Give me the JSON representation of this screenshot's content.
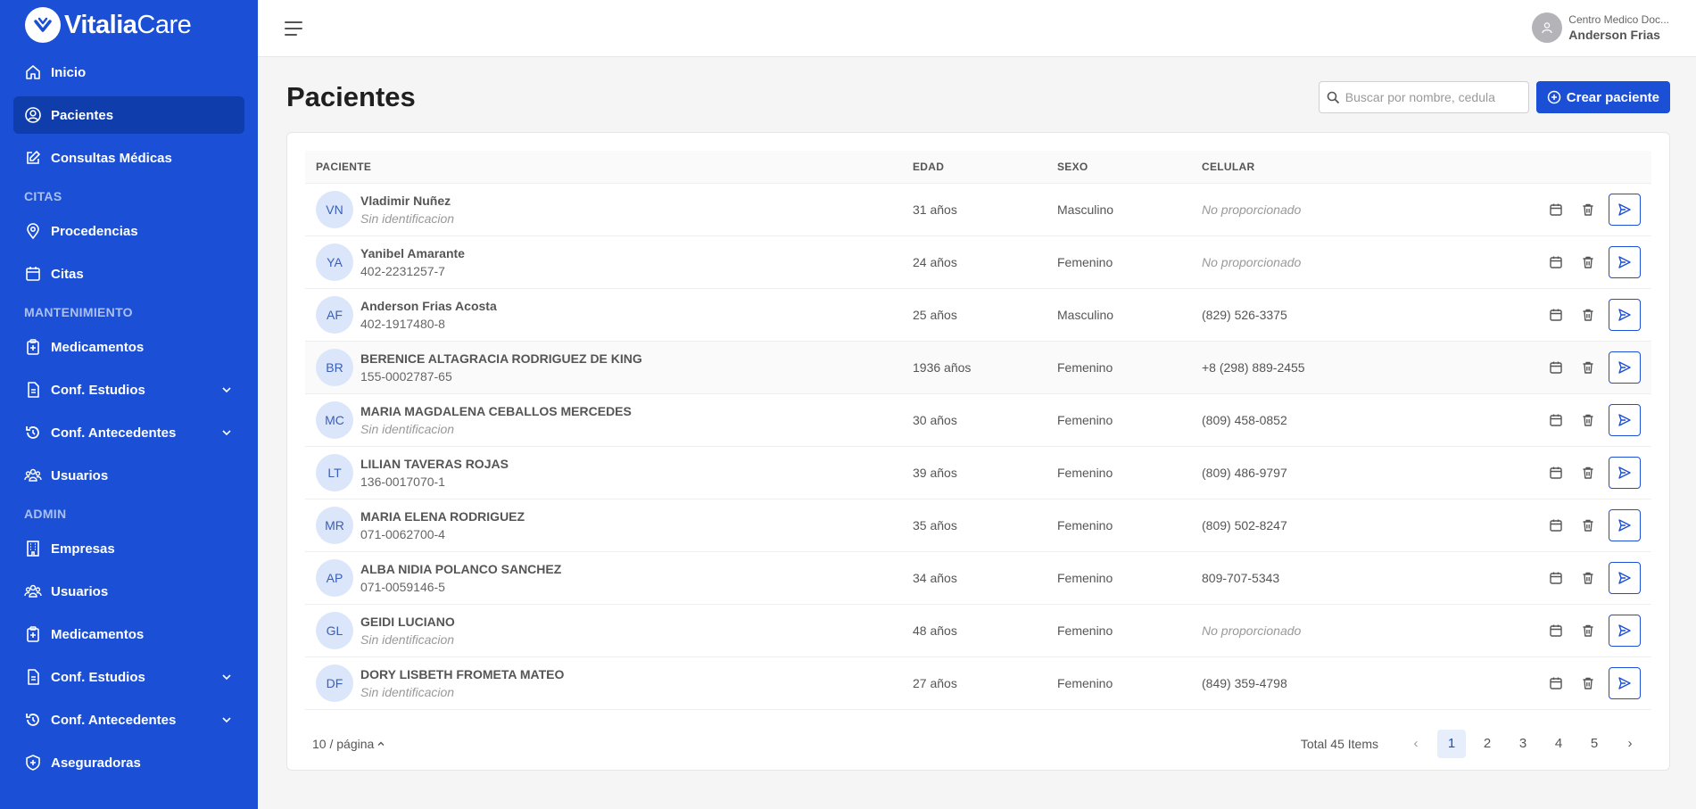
{
  "brand": {
    "name_bold": "Vitalia",
    "name_light": "Care"
  },
  "sidebar": {
    "items": [
      {
        "label": "Inicio"
      },
      {
        "label": "Pacientes"
      },
      {
        "label": "Consultas Médicas"
      },
      {
        "label": "Procedencias"
      },
      {
        "label": "Citas"
      },
      {
        "label": "Medicamentos"
      },
      {
        "label": "Conf. Estudios"
      },
      {
        "label": "Conf. Antecedentes"
      },
      {
        "label": "Usuarios"
      },
      {
        "label": "Empresas"
      },
      {
        "label": "Usuarios"
      },
      {
        "label": "Medicamentos"
      },
      {
        "label": "Conf. Estudios"
      },
      {
        "label": "Conf. Antecedentes"
      },
      {
        "label": "Aseguradoras"
      }
    ],
    "sections": {
      "citas": "CITAS",
      "mantenimiento": "MANTENIMIENTO",
      "admin": "ADMIN"
    }
  },
  "topbar": {
    "company": "Centro Medico Doc...",
    "user_name": "Anderson Frias"
  },
  "page": {
    "title": "Pacientes",
    "search_placeholder": "Buscar por nombre, cedula",
    "create_label": "Crear paciente"
  },
  "table": {
    "headers": {
      "patient": "PACIENTE",
      "age": "EDAD",
      "sex": "SEXO",
      "phone": "CELULAR"
    },
    "rows": [
      {
        "initials": "VN",
        "name": "Vladimir Nuñez",
        "id": "Sin identificacion",
        "age": "31 años",
        "sex": "Masculino",
        "phone": "No proporcionado"
      },
      {
        "initials": "YA",
        "name": "Yanibel Amarante",
        "id": "402-2231257-7",
        "age": "24 años",
        "sex": "Femenino",
        "phone": "No proporcionado"
      },
      {
        "initials": "AF",
        "name": "Anderson Frias Acosta",
        "id": "402-1917480-8",
        "age": "25 años",
        "sex": "Masculino",
        "phone": "(829) 526-3375"
      },
      {
        "initials": "BR",
        "name": "BERENICE ALTAGRACIA RODRIGUEZ DE KING",
        "id": "155-0002787-65",
        "age": "1936 años",
        "sex": "Femenino",
        "phone": "+8 (298) 889-2455"
      },
      {
        "initials": "MC",
        "name": "MARIA MAGDALENA CEBALLOS MERCEDES",
        "id": "Sin identificacion",
        "age": "30 años",
        "sex": "Femenino",
        "phone": "(809) 458-0852"
      },
      {
        "initials": "LT",
        "name": "LILIAN TAVERAS ROJAS",
        "id": "136-0017070-1",
        "age": "39 años",
        "sex": "Femenino",
        "phone": "(809) 486-9797"
      },
      {
        "initials": "MR",
        "name": "MARIA ELENA RODRIGUEZ",
        "id": "071-0062700-4",
        "age": "35 años",
        "sex": "Femenino",
        "phone": "(809) 502-8247"
      },
      {
        "initials": "AP",
        "name": "ALBA NIDIA POLANCO SANCHEZ",
        "id": "071-0059146-5",
        "age": "34 años",
        "sex": "Femenino",
        "phone": "809-707-5343"
      },
      {
        "initials": "GL",
        "name": "GEIDI LUCIANO",
        "id": "Sin identificacion",
        "age": "48 años",
        "sex": "Femenino",
        "phone": "No proporcionado"
      },
      {
        "initials": "DF",
        "name": "DORY LISBETH FROMETA MATEO",
        "id": "Sin identificacion",
        "age": "27 años",
        "sex": "Femenino",
        "phone": "(849) 359-4798"
      }
    ]
  },
  "pagination": {
    "page_size": "10 / página",
    "total": "Total 45 Items",
    "pages": [
      "1",
      "2",
      "3",
      "4",
      "5"
    ],
    "prev": "‹",
    "next": "›"
  },
  "colors": {
    "primary": "#1a4fd6",
    "sidebar_active": "#0f3dab"
  }
}
